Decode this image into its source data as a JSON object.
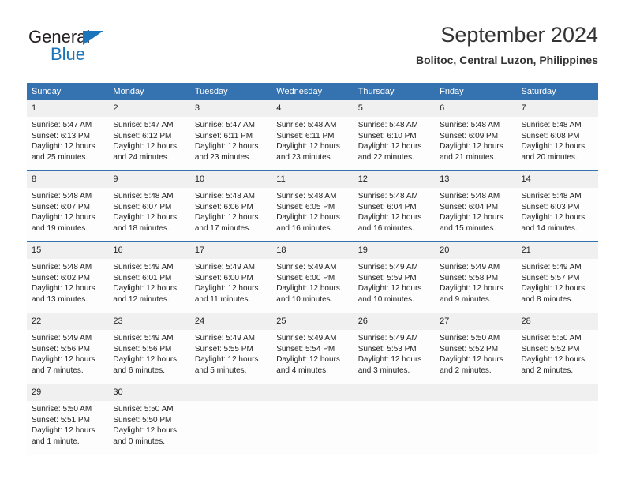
{
  "brand": {
    "name_part1": "General",
    "name_part2": "Blue",
    "triangle_icon": "triangle-icon",
    "accent_color": "#1b75bb"
  },
  "header": {
    "title": "September 2024",
    "subtitle": "Bolitoc, Central Luzon, Philippines"
  },
  "colors": {
    "header_blue": "#3572b0",
    "daynum_gray": "#f0f0f0",
    "brand_blue": "#1b75bb"
  },
  "weekday_headers": [
    "Sunday",
    "Monday",
    "Tuesday",
    "Wednesday",
    "Thursday",
    "Friday",
    "Saturday"
  ],
  "weeks": [
    [
      {
        "day": "1",
        "sunrise": "Sunrise: 5:47 AM",
        "sunset": "Sunset: 6:13 PM",
        "daylight1": "Daylight: 12 hours",
        "daylight2": "and 25 minutes."
      },
      {
        "day": "2",
        "sunrise": "Sunrise: 5:47 AM",
        "sunset": "Sunset: 6:12 PM",
        "daylight1": "Daylight: 12 hours",
        "daylight2": "and 24 minutes."
      },
      {
        "day": "3",
        "sunrise": "Sunrise: 5:47 AM",
        "sunset": "Sunset: 6:11 PM",
        "daylight1": "Daylight: 12 hours",
        "daylight2": "and 23 minutes."
      },
      {
        "day": "4",
        "sunrise": "Sunrise: 5:48 AM",
        "sunset": "Sunset: 6:11 PM",
        "daylight1": "Daylight: 12 hours",
        "daylight2": "and 23 minutes."
      },
      {
        "day": "5",
        "sunrise": "Sunrise: 5:48 AM",
        "sunset": "Sunset: 6:10 PM",
        "daylight1": "Daylight: 12 hours",
        "daylight2": "and 22 minutes."
      },
      {
        "day": "6",
        "sunrise": "Sunrise: 5:48 AM",
        "sunset": "Sunset: 6:09 PM",
        "daylight1": "Daylight: 12 hours",
        "daylight2": "and 21 minutes."
      },
      {
        "day": "7",
        "sunrise": "Sunrise: 5:48 AM",
        "sunset": "Sunset: 6:08 PM",
        "daylight1": "Daylight: 12 hours",
        "daylight2": "and 20 minutes."
      }
    ],
    [
      {
        "day": "8",
        "sunrise": "Sunrise: 5:48 AM",
        "sunset": "Sunset: 6:07 PM",
        "daylight1": "Daylight: 12 hours",
        "daylight2": "and 19 minutes."
      },
      {
        "day": "9",
        "sunrise": "Sunrise: 5:48 AM",
        "sunset": "Sunset: 6:07 PM",
        "daylight1": "Daylight: 12 hours",
        "daylight2": "and 18 minutes."
      },
      {
        "day": "10",
        "sunrise": "Sunrise: 5:48 AM",
        "sunset": "Sunset: 6:06 PM",
        "daylight1": "Daylight: 12 hours",
        "daylight2": "and 17 minutes."
      },
      {
        "day": "11",
        "sunrise": "Sunrise: 5:48 AM",
        "sunset": "Sunset: 6:05 PM",
        "daylight1": "Daylight: 12 hours",
        "daylight2": "and 16 minutes."
      },
      {
        "day": "12",
        "sunrise": "Sunrise: 5:48 AM",
        "sunset": "Sunset: 6:04 PM",
        "daylight1": "Daylight: 12 hours",
        "daylight2": "and 16 minutes."
      },
      {
        "day": "13",
        "sunrise": "Sunrise: 5:48 AM",
        "sunset": "Sunset: 6:04 PM",
        "daylight1": "Daylight: 12 hours",
        "daylight2": "and 15 minutes."
      },
      {
        "day": "14",
        "sunrise": "Sunrise: 5:48 AM",
        "sunset": "Sunset: 6:03 PM",
        "daylight1": "Daylight: 12 hours",
        "daylight2": "and 14 minutes."
      }
    ],
    [
      {
        "day": "15",
        "sunrise": "Sunrise: 5:48 AM",
        "sunset": "Sunset: 6:02 PM",
        "daylight1": "Daylight: 12 hours",
        "daylight2": "and 13 minutes."
      },
      {
        "day": "16",
        "sunrise": "Sunrise: 5:49 AM",
        "sunset": "Sunset: 6:01 PM",
        "daylight1": "Daylight: 12 hours",
        "daylight2": "and 12 minutes."
      },
      {
        "day": "17",
        "sunrise": "Sunrise: 5:49 AM",
        "sunset": "Sunset: 6:00 PM",
        "daylight1": "Daylight: 12 hours",
        "daylight2": "and 11 minutes."
      },
      {
        "day": "18",
        "sunrise": "Sunrise: 5:49 AM",
        "sunset": "Sunset: 6:00 PM",
        "daylight1": "Daylight: 12 hours",
        "daylight2": "and 10 minutes."
      },
      {
        "day": "19",
        "sunrise": "Sunrise: 5:49 AM",
        "sunset": "Sunset: 5:59 PM",
        "daylight1": "Daylight: 12 hours",
        "daylight2": "and 10 minutes."
      },
      {
        "day": "20",
        "sunrise": "Sunrise: 5:49 AM",
        "sunset": "Sunset: 5:58 PM",
        "daylight1": "Daylight: 12 hours",
        "daylight2": "and 9 minutes."
      },
      {
        "day": "21",
        "sunrise": "Sunrise: 5:49 AM",
        "sunset": "Sunset: 5:57 PM",
        "daylight1": "Daylight: 12 hours",
        "daylight2": "and 8 minutes."
      }
    ],
    [
      {
        "day": "22",
        "sunrise": "Sunrise: 5:49 AM",
        "sunset": "Sunset: 5:56 PM",
        "daylight1": "Daylight: 12 hours",
        "daylight2": "and 7 minutes."
      },
      {
        "day": "23",
        "sunrise": "Sunrise: 5:49 AM",
        "sunset": "Sunset: 5:56 PM",
        "daylight1": "Daylight: 12 hours",
        "daylight2": "and 6 minutes."
      },
      {
        "day": "24",
        "sunrise": "Sunrise: 5:49 AM",
        "sunset": "Sunset: 5:55 PM",
        "daylight1": "Daylight: 12 hours",
        "daylight2": "and 5 minutes."
      },
      {
        "day": "25",
        "sunrise": "Sunrise: 5:49 AM",
        "sunset": "Sunset: 5:54 PM",
        "daylight1": "Daylight: 12 hours",
        "daylight2": "and 4 minutes."
      },
      {
        "day": "26",
        "sunrise": "Sunrise: 5:49 AM",
        "sunset": "Sunset: 5:53 PM",
        "daylight1": "Daylight: 12 hours",
        "daylight2": "and 3 minutes."
      },
      {
        "day": "27",
        "sunrise": "Sunrise: 5:50 AM",
        "sunset": "Sunset: 5:52 PM",
        "daylight1": "Daylight: 12 hours",
        "daylight2": "and 2 minutes."
      },
      {
        "day": "28",
        "sunrise": "Sunrise: 5:50 AM",
        "sunset": "Sunset: 5:52 PM",
        "daylight1": "Daylight: 12 hours",
        "daylight2": "and 2 minutes."
      }
    ],
    [
      {
        "day": "29",
        "sunrise": "Sunrise: 5:50 AM",
        "sunset": "Sunset: 5:51 PM",
        "daylight1": "Daylight: 12 hours",
        "daylight2": "and 1 minute."
      },
      {
        "day": "30",
        "sunrise": "Sunrise: 5:50 AM",
        "sunset": "Sunset: 5:50 PM",
        "daylight1": "Daylight: 12 hours",
        "daylight2": "and 0 minutes."
      },
      {
        "day": "",
        "sunrise": "",
        "sunset": "",
        "daylight1": "",
        "daylight2": ""
      },
      {
        "day": "",
        "sunrise": "",
        "sunset": "",
        "daylight1": "",
        "daylight2": ""
      },
      {
        "day": "",
        "sunrise": "",
        "sunset": "",
        "daylight1": "",
        "daylight2": ""
      },
      {
        "day": "",
        "sunrise": "",
        "sunset": "",
        "daylight1": "",
        "daylight2": ""
      },
      {
        "day": "",
        "sunrise": "",
        "sunset": "",
        "daylight1": "",
        "daylight2": ""
      }
    ]
  ]
}
